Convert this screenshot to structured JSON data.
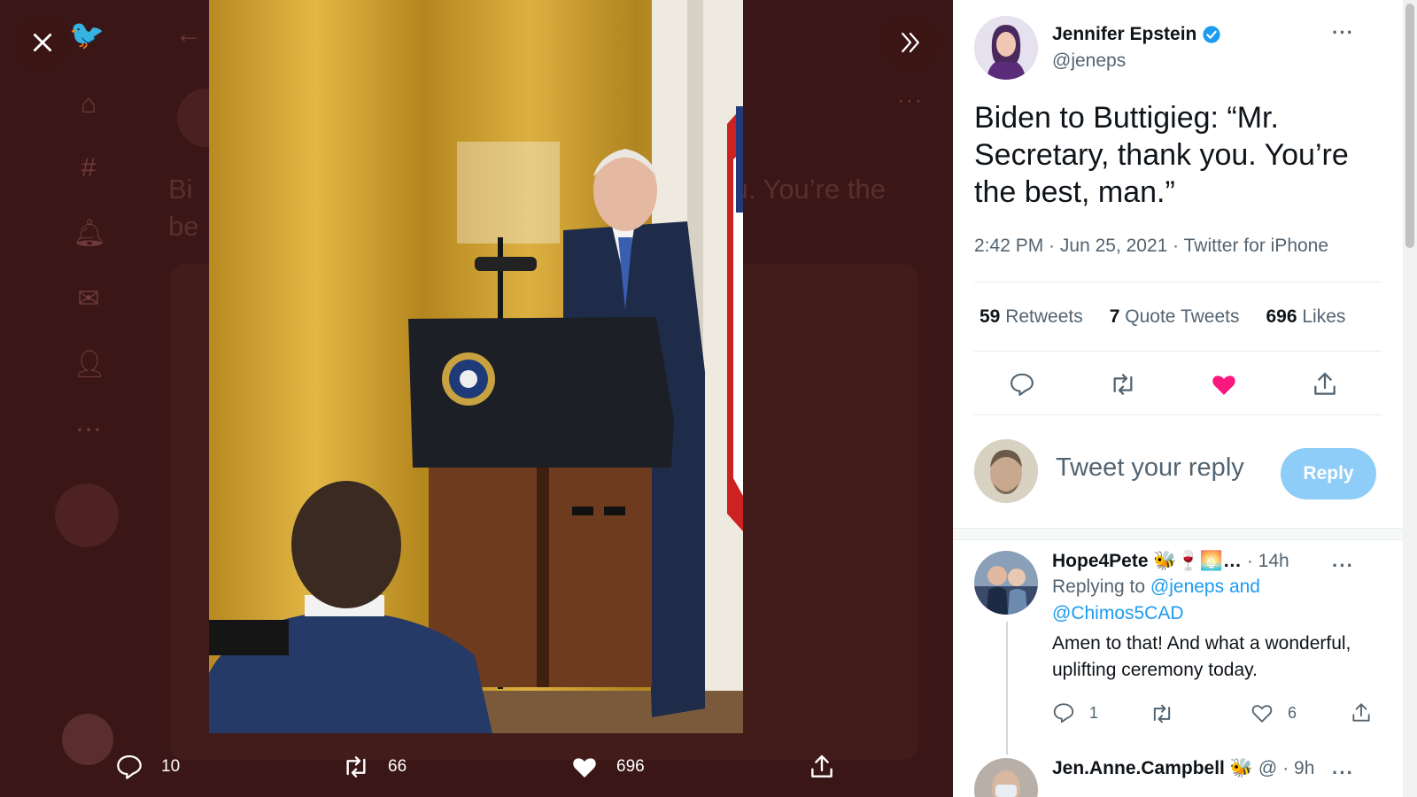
{
  "overlay": {
    "close_icon": "close-icon",
    "expand_icon": "chevron-double-right-icon"
  },
  "background": {
    "partial_text_line1": "Bi",
    "partial_text_line1_right": "u. You’re the",
    "partial_text_line2": "be"
  },
  "media_actions": {
    "reply_count": "10",
    "retweet_count": "66",
    "like_count": "696"
  },
  "tweet": {
    "author_name": "Jennifer Epstein",
    "author_handle": "@jeneps",
    "verified": true,
    "text": "Biden to Buttigieg: “Mr. Secretary, thank you. You’re the best, man.”",
    "time": "2:42 PM",
    "date": "Jun 25, 2021",
    "source": "Twitter for iPhone",
    "meta_sep": " · ",
    "retweets_count": "59",
    "retweets_label": "Retweets",
    "quote_count": "7",
    "quote_label": "Quote Tweets",
    "likes_count": "696",
    "likes_label": "Likes",
    "more": "···"
  },
  "composer": {
    "placeholder": "Tweet your reply",
    "button": "Reply"
  },
  "replies": [
    {
      "name": "Hope4Pete 🐝🍷🌅…",
      "time": "· 14h",
      "replying_prefix": "Replying to ",
      "replying_to": "@jeneps and @Chimos5CAD",
      "text": "Amen to that!  And what a wonderful, uplifting ceremony today.",
      "reply_count": "1",
      "retweet_count": "",
      "like_count": "6"
    },
    {
      "name": "Jen.Anne.Campbell 🐝",
      "handle": "@",
      "time": "· 9h"
    }
  ],
  "colors": {
    "accent": "#1d9bf0",
    "like": "#f91880",
    "overlay_bg": "#3a1616"
  }
}
